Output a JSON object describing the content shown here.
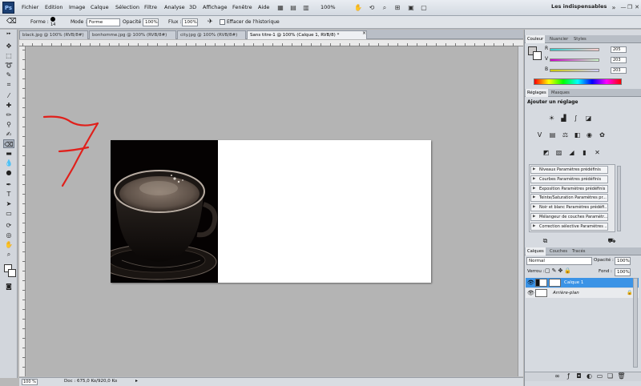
{
  "menubar": {
    "app_icon": "Ps",
    "items": [
      "Fichier",
      "Edition",
      "Image",
      "Calque",
      "Sélection",
      "Filtre",
      "Analyse",
      "3D",
      "Affichage",
      "Fenêtre",
      "Aide"
    ],
    "zoom": "100%",
    "workspace": "Les indispensables"
  },
  "options": {
    "forme_label": "Forme :",
    "brush_size": "14",
    "mode_label": "Mode :",
    "mode_value": "Forme",
    "opacity_label": "Opacité :",
    "opacity_value": "100%",
    "flux_label": "Flux :",
    "flux_value": "100%",
    "history_label": "Effacer de l'historique"
  },
  "tabs": [
    {
      "label": "black.jpg @ 100% (RVB/8#)"
    },
    {
      "label": "bonhomme.jpg @ 100% (RVB/8#)"
    },
    {
      "label": "city.jpg @ 100% (RVB/8#)"
    },
    {
      "label": "Sans titre-1 @ 100% (Calque 1, RVB/8) *"
    }
  ],
  "annotation": {
    "text": "7",
    "color": "#e0201b"
  },
  "status": {
    "zoom": "100 %",
    "doc": "Doc : 675,0 Ko/920,0 Ko"
  },
  "color_panel": {
    "tabs": [
      "Couleur",
      "Nuancier",
      "Styles"
    ],
    "channels": [
      {
        "label": "R",
        "value": "205"
      },
      {
        "label": "V",
        "value": "203"
      },
      {
        "label": "B",
        "value": "203"
      }
    ]
  },
  "adjustments_panel": {
    "tabs": [
      "Réglages",
      "Masques"
    ],
    "title": "Ajouter un réglage",
    "presets": [
      "Niveaux Paramètres prédéfinis",
      "Courbes Paramètres prédéfinis",
      "Exposition Paramètres prédéfinis",
      "Teinte/Saturation Paramètres pr...",
      "Noir et blanc Paramètres prédéfi...",
      "Mélangeur de couches Paramètr...",
      "Correction sélective Paramètres ..."
    ]
  },
  "layers_panel": {
    "tabs": [
      "Calques",
      "Couches",
      "Tracés"
    ],
    "blend_mode": "Normal",
    "opacity_label": "Opacité :",
    "opacity_value": "100%",
    "lock_label": "Verrou :",
    "fill_label": "Fond :",
    "fill_value": "100%",
    "layers": [
      {
        "name": "Calque 1",
        "selected": true
      },
      {
        "name": "Arrière-plan",
        "selected": false
      }
    ]
  },
  "colors": {
    "accent": "#3b93e6",
    "panel": "#d6dae0"
  }
}
